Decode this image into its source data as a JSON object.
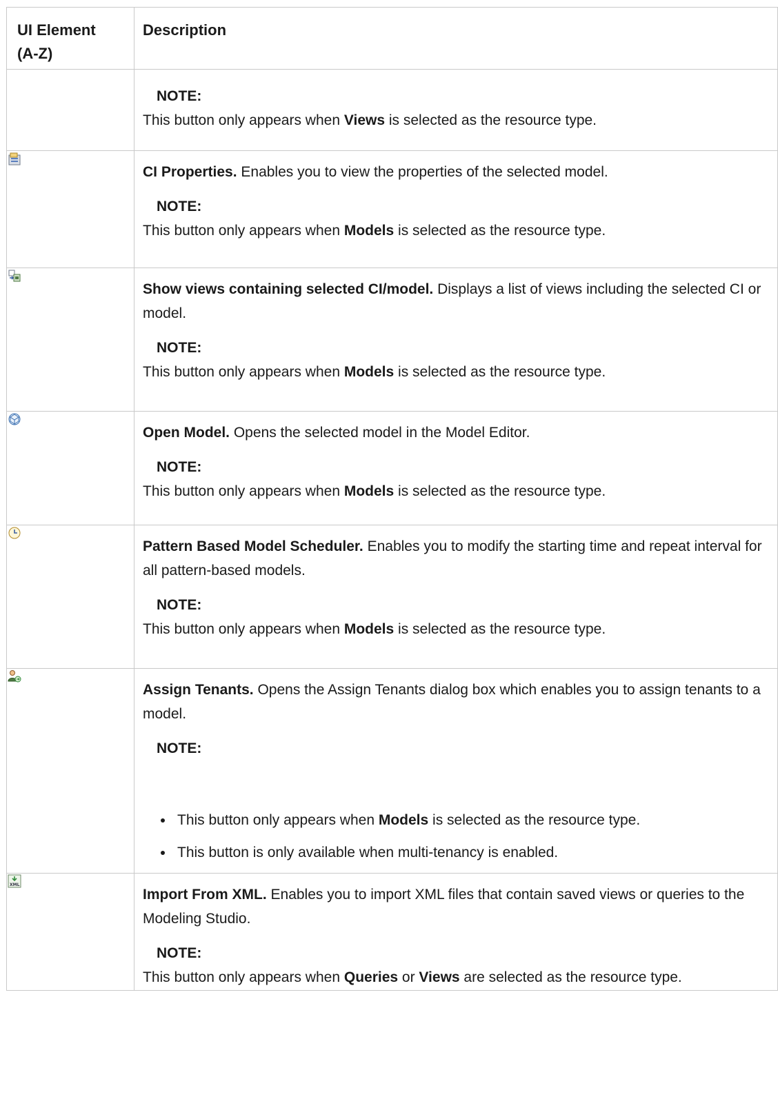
{
  "table": {
    "headers": {
      "element": "UI Element (A-Z)",
      "description": "Description"
    },
    "rows": [
      {
        "icon": null,
        "title": "",
        "text": "",
        "note_label": "NOTE:",
        "note_parts": [
          "This button only appears when ",
          "Views",
          " is selected as the resource type."
        ]
      },
      {
        "icon": "ci-properties-icon",
        "title": "CI Properties.",
        "text": " Enables you to view the properties of the selected model.",
        "note_label": "NOTE:",
        "note_parts": [
          "This button only appears when ",
          "Models",
          " is selected as the resource type."
        ]
      },
      {
        "icon": "show-views-icon",
        "title": "Show views containing selected CI/model.",
        "text": " Displays a list of views including the selected CI or model.",
        "note_label": "NOTE:",
        "note_parts": [
          "This button only appears when ",
          "Models",
          " is selected as the resource type."
        ]
      },
      {
        "icon": "open-model-icon",
        "title": "Open Model.",
        "text": " Opens the selected model in the Model Editor.",
        "note_label": "NOTE:",
        "note_parts": [
          "This button only appears when ",
          "Models",
          " is selected as the resource type."
        ]
      },
      {
        "icon": "clock-icon",
        "title": "Pattern Based Model Scheduler.",
        "text": " Enables you to modify the starting time and repeat interval for all pattern-based models.",
        "note_label": "NOTE:",
        "note_parts": [
          "This button only appears when ",
          "Models",
          " is selected as the resource type."
        ]
      },
      {
        "icon": "assign-tenants-icon",
        "title": "Assign Tenants.",
        "text": " Opens the Assign Tenants dialog box which enables you to assign tenants to a model.",
        "note_label": "NOTE:",
        "bullets": [
          [
            "This button only appears when ",
            "Models",
            " is selected as the resource type."
          ],
          [
            "This button is only available when multi-tenancy is enabled."
          ]
        ]
      },
      {
        "icon": "import-xml-icon",
        "title": "Import From XML.",
        "text": " Enables you to import XML files that contain saved views or queries to the Modeling Studio.",
        "note_label": "NOTE:",
        "note_parts": [
          "This button only appears when ",
          "Queries",
          " or ",
          "Views",
          " are selected as the resource type."
        ]
      }
    ]
  },
  "colors": {
    "border": "#c9c9c9",
    "text": "#1a1a1a"
  }
}
